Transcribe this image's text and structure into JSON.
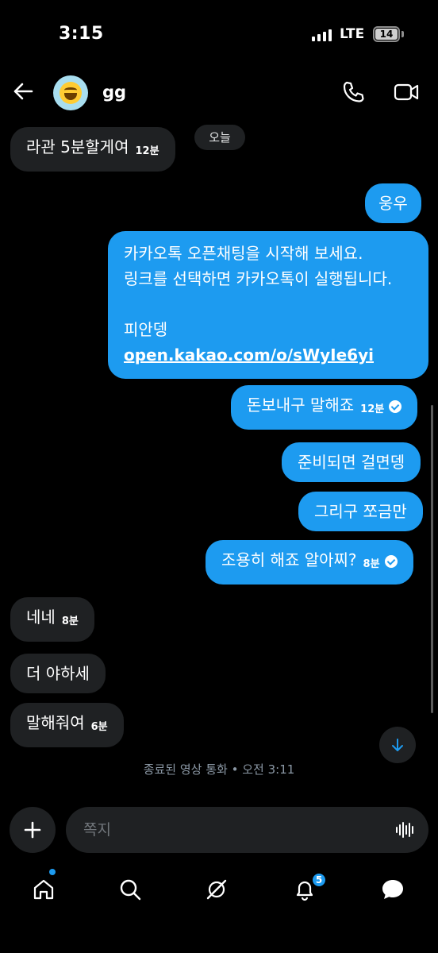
{
  "status_bar": {
    "time": "3:15",
    "network": "LTE",
    "battery": "14"
  },
  "header": {
    "contact_name": "gg",
    "avatar_icon": "grinning-face-emoji"
  },
  "date_divider": "오늘",
  "messages": [
    {
      "side": "in",
      "text": "라관 5분할게여",
      "time": "12분"
    },
    {
      "side": "out",
      "text": "웅우"
    },
    {
      "side": "out",
      "lines": [
        "카카오톡 오픈채팅을 시작해 보세요.",
        "링크를 선택하면 카카오톡이 실행됩니다.",
        "",
        "피안뎅"
      ],
      "link": "open.kakao.com/o/sWyIe6yi"
    },
    {
      "side": "out",
      "text": "돈보내구 말해죠",
      "time": "12분",
      "read": true
    },
    {
      "side": "out",
      "text": "준비되면 걸면뎅"
    },
    {
      "side": "out",
      "text": "그리구 쪼금만"
    },
    {
      "side": "out",
      "text": "조용히 해죠 알아찌?",
      "time": "8분",
      "read": true
    },
    {
      "side": "in",
      "text": "네네",
      "time": "8분"
    },
    {
      "side": "in",
      "text": "더 야하세"
    },
    {
      "side": "in",
      "text": "말해줘여",
      "time": "6분"
    }
  ],
  "call_note": "종료된 영상 통화 • 오전 3:11",
  "composer": {
    "placeholder": "쪽지"
  },
  "nav": {
    "notifications_badge": "5"
  },
  "colors": {
    "accent": "#1d9bf0",
    "incoming_bubble": "#1f2123",
    "background": "#000000"
  }
}
